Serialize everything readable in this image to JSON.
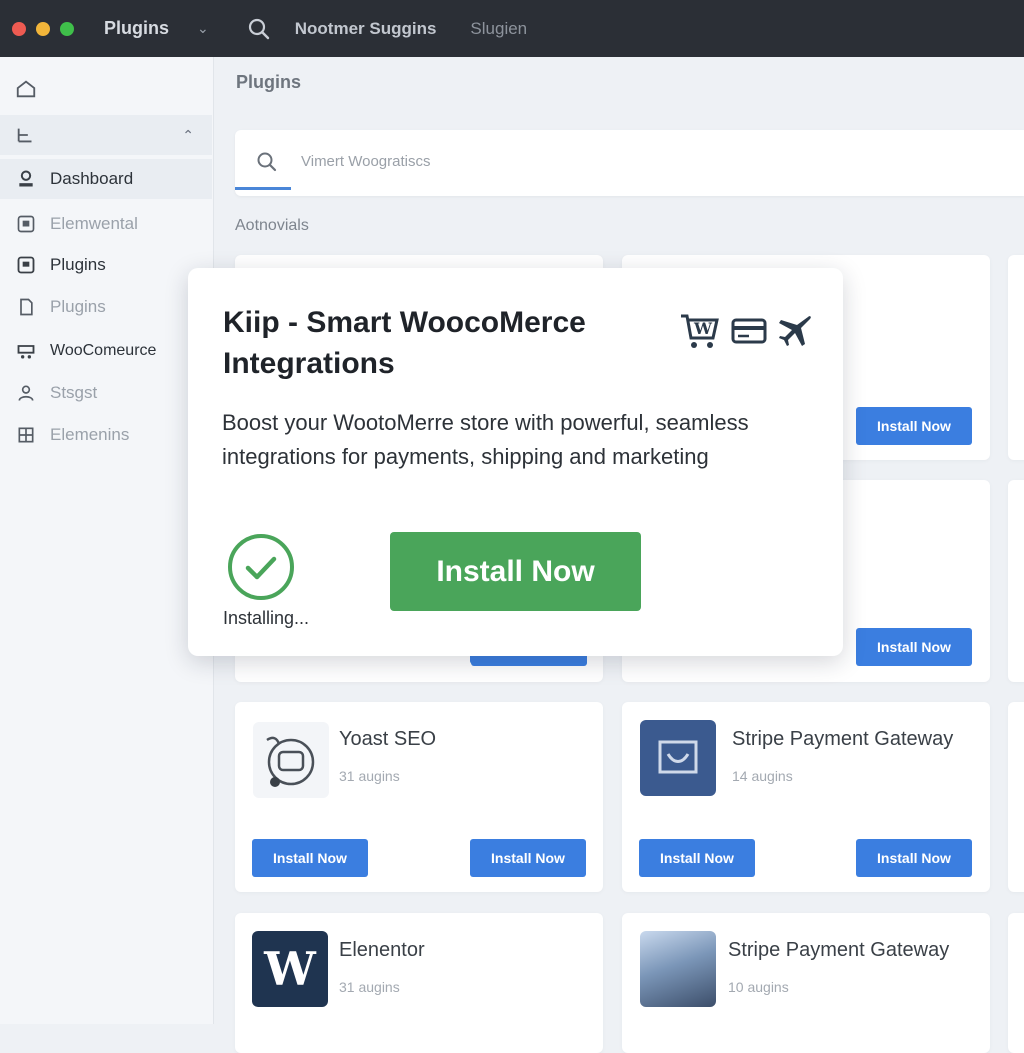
{
  "titlebar": {
    "app_title": "Plugins",
    "text1": "Nootmer Suggins",
    "text2": "Slugien"
  },
  "sidebar": {
    "items": [
      {
        "label": "",
        "icon": "home-icon"
      },
      {
        "label": "",
        "icon": "menu-icon"
      },
      {
        "label": "Dashboard",
        "icon": "dashboard-icon"
      },
      {
        "label": "Elemwental",
        "icon": "element-icon"
      },
      {
        "label": "Plugins",
        "icon": "plugin-icon"
      },
      {
        "label": "Plugins",
        "icon": "plugin-outline-icon"
      },
      {
        "label": "WooComeurce",
        "icon": "woocommerce-icon"
      },
      {
        "label": "Stsgst",
        "icon": "users-icon"
      },
      {
        "label": "Elemenins",
        "icon": "grid-icon"
      }
    ]
  },
  "main": {
    "title": "Plugins",
    "search_text": "Vimert Woogratiscs",
    "section_label": "Aotnovials"
  },
  "cards": {
    "install_label": "Install Now",
    "row3": [
      {
        "name": "Yoast SEO",
        "meta": "31 augins"
      },
      {
        "name": "Stripe Payment Gateway",
        "meta": "14 augins"
      }
    ],
    "row4": [
      {
        "name": "Elenentor",
        "meta": "31 augins"
      },
      {
        "name": "Stripe Payment Gateway",
        "meta": "10 augins"
      }
    ]
  },
  "modal": {
    "title": "Kiip - Smart WoocoMerce Integrations",
    "description": "Boost your WootoMerre store with powerful, seamless integrations for payments, shipping and marketing",
    "install_label": "Install Now",
    "status": "Installing...",
    "icons": [
      "woocommerce-cart-icon",
      "credit-card-icon",
      "airplane-icon"
    ]
  },
  "colors": {
    "accent_blue": "#3b7ee0",
    "install_green": "#4aa55a",
    "titlebar": "#2b2f36"
  }
}
